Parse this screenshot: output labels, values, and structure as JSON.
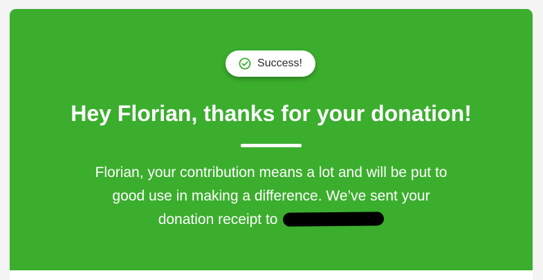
{
  "status_pill": {
    "label": "Success!",
    "icon": "check-circle-icon",
    "icon_color": "#3bae2d"
  },
  "heading": "Hey Florian, thanks for your donation!",
  "message": "Florian, your contribution means a lot and will be put to good use in making a difference. We’ve sent your donation receipt to ",
  "colors": {
    "banner": "#3bae2d",
    "text": "#ffffff"
  }
}
